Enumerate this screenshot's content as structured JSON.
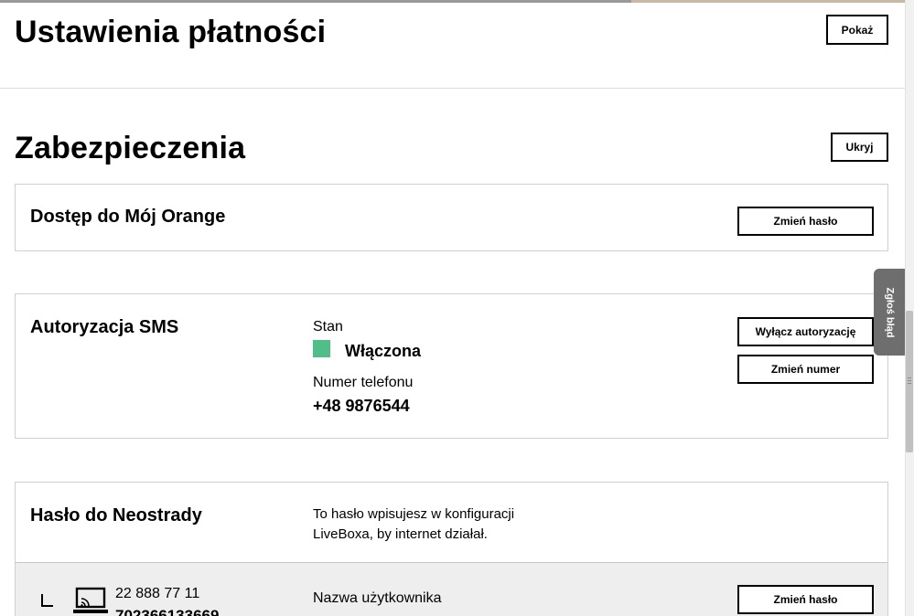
{
  "payment_section": {
    "title": "Ustawienia płatności",
    "toggle_label": "Pokaż"
  },
  "security_section": {
    "title": "Zabezpieczenia",
    "toggle_label": "Ukryj"
  },
  "moj_orange": {
    "title": "Dostęp do Mój Orange",
    "change_password_label": "Zmień hasło"
  },
  "sms_auth": {
    "title": "Autoryzacja SMS",
    "state_label": "Stan",
    "state_value": "Włączona",
    "state_color": "#50be87",
    "phone_label": "Numer telefonu",
    "phone_value": "+48 9876544",
    "disable_label": "Wyłącz autoryzację",
    "change_number_label": "Zmień numer"
  },
  "neostrada": {
    "title": "Hasło do Neostrady",
    "description_line1": "To hasło wpisujesz w konfiguracji",
    "description_line2": "LiveBoxa, by internet działał.",
    "line_number": "22 888 77 11",
    "line_id_partial": "702366133669",
    "username_label": "Nazwa użytkownika",
    "change_password_label": "Zmień hasło"
  },
  "side_tab": {
    "label": "Zgłoś błąd"
  }
}
